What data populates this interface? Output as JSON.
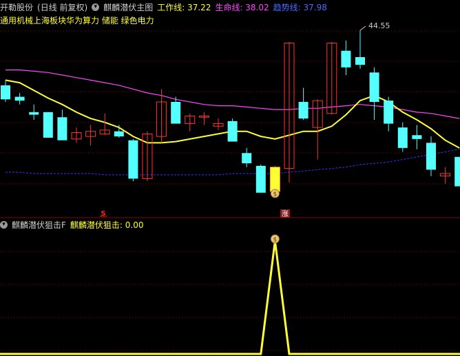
{
  "main_header": {
    "stock_name": "开勒股份",
    "period": "(日线 前复权)",
    "indicator_name": "麒麟潜伏主图",
    "work_line_label": "工作线: 37.22",
    "life_line_label": "生命线: 38.02",
    "trend_line_label": "趋势线: 37.98",
    "concepts": "通用机械上海板块华为算力 储能 绿色电力"
  },
  "sub_header": {
    "indicator_name": "麒麟潜伏狙击F",
    "value_label": "麒麟潜伏狙击: 0.00"
  },
  "markers": {
    "peak_label": "44.55",
    "coin_glyph": "$",
    "s_marker": "S",
    "zhang_marker": "涨"
  },
  "colors": {
    "background": "#000000",
    "up": "#ff3333",
    "down": "#54ffff",
    "work_line": "#ffff33",
    "life_line": "#ff44ff",
    "trend_line": "#3333ff",
    "grid": "#8b0000",
    "text_label": "#cccccc"
  },
  "chart_data": {
    "type": "candlestick",
    "y_range": [
      31.5,
      45.5
    ],
    "candles": [
      {
        "o": 39.8,
        "h": 40.2,
        "l": 38.5,
        "c": 38.7
      },
      {
        "o": 38.9,
        "h": 39.2,
        "l": 38.3,
        "c": 38.6
      },
      {
        "o": 37.7,
        "h": 38.3,
        "l": 37.1,
        "c": 37.5
      },
      {
        "o": 37.7,
        "h": 37.7,
        "l": 35.9,
        "c": 35.7
      },
      {
        "o": 37.3,
        "h": 37.9,
        "l": 35.6,
        "c": 35.5
      },
      {
        "o": 35.6,
        "h": 36.5,
        "l": 35.3,
        "c": 36.1
      },
      {
        "o": 35.8,
        "h": 36.7,
        "l": 35.1,
        "c": 36.2
      },
      {
        "o": 36.0,
        "h": 37.6,
        "l": 35.9,
        "c": 36.3
      },
      {
        "o": 36.2,
        "h": 36.7,
        "l": 35.7,
        "c": 35.8
      },
      {
        "o": 35.5,
        "h": 35.6,
        "l": 32.3,
        "c": 32.5
      },
      {
        "o": 32.5,
        "h": 36.2,
        "l": 32.3,
        "c": 36.0
      },
      {
        "o": 35.8,
        "h": 39.5,
        "l": 35.3,
        "c": 38.5
      },
      {
        "o": 38.5,
        "h": 38.9,
        "l": 36.9,
        "c": 36.8
      },
      {
        "o": 36.8,
        "h": 37.6,
        "l": 36.2,
        "c": 37.4
      },
      {
        "o": 37.3,
        "h": 37.7,
        "l": 36.7,
        "c": 37.4
      },
      {
        "o": 36.6,
        "h": 37.2,
        "l": 36.3,
        "c": 36.8
      },
      {
        "o": 37.0,
        "h": 37.2,
        "l": 35.7,
        "c": 35.4
      },
      {
        "o": 34.5,
        "h": 34.9,
        "l": 33.4,
        "c": 33.7
      },
      {
        "o": 33.5,
        "h": 33.6,
        "l": 31.5,
        "c": 31.4
      },
      {
        "o": 31.5,
        "h": 33.5,
        "l": 31.5,
        "c": 33.4
      },
      {
        "o": 33.3,
        "h": 43.2,
        "l": 32.2,
        "c": 43.1
      },
      {
        "o": 38.5,
        "h": 39.6,
        "l": 37.1,
        "c": 37.2
      },
      {
        "o": 36.5,
        "h": 38.7,
        "l": 34.0,
        "c": 38.6
      },
      {
        "o": 37.6,
        "h": 43.2,
        "l": 37.5,
        "c": 43.1
      },
      {
        "o": 42.5,
        "h": 43.3,
        "l": 40.6,
        "c": 41.2
      },
      {
        "o": 42.0,
        "h": 44.1,
        "l": 41.1,
        "c": 41.4
      },
      {
        "o": 40.8,
        "h": 41.2,
        "l": 37.1,
        "c": 38.5
      },
      {
        "o": 38.6,
        "h": 38.9,
        "l": 36.2,
        "c": 36.8
      },
      {
        "o": 36.5,
        "h": 36.9,
        "l": 34.6,
        "c": 34.9
      },
      {
        "o": 35.9,
        "h": 36.7,
        "l": 34.8,
        "c": 35.6
      },
      {
        "o": 35.3,
        "h": 35.8,
        "l": 32.7,
        "c": 33.2
      },
      {
        "o": 32.7,
        "h": 33.4,
        "l": 32.1,
        "c": 32.9
      },
      {
        "o": 34.2,
        "h": 34.2,
        "l": 32.1,
        "c": 31.9
      }
    ],
    "work_line": [
      40.2,
      40.0,
      39.4,
      38.8,
      38.3,
      37.7,
      37.2,
      36.9,
      36.5,
      35.8,
      35.3,
      35.3,
      35.4,
      35.6,
      35.8,
      36.0,
      36.2,
      36.2,
      35.8,
      35.6,
      35.9,
      36.2,
      36.2,
      36.6,
      37.5,
      38.6,
      39.0,
      38.5,
      37.7,
      37.1,
      36.4,
      35.5,
      34.9
    ],
    "life_line": [
      41.0,
      41.0,
      40.9,
      40.8,
      40.6,
      40.4,
      40.2,
      40.0,
      39.8,
      39.5,
      39.2,
      39.0,
      38.7,
      38.5,
      38.3,
      38.2,
      38.2,
      38.1,
      38.0,
      37.9,
      37.9,
      38.0,
      38.0,
      38.1,
      38.2,
      38.3,
      38.2,
      38.1,
      37.9,
      37.7,
      37.6,
      37.4,
      37.2
    ],
    "trend_line": [
      33.0,
      33.0,
      32.9,
      32.9,
      32.9,
      32.9,
      32.9,
      32.8,
      32.8,
      32.8,
      32.8,
      32.8,
      32.8,
      32.8,
      32.8,
      32.8,
      32.9,
      32.9,
      32.9,
      32.9,
      33.0,
      33.1,
      33.2,
      33.3,
      33.4,
      33.6,
      33.7,
      33.8,
      34.0,
      34.2,
      34.4,
      34.6,
      34.8
    ],
    "sniper": {
      "values": [
        0,
        0,
        0,
        0,
        0,
        0,
        0,
        0,
        0,
        0,
        0,
        0,
        0,
        0,
        0,
        0,
        0,
        0,
        0,
        1,
        0,
        0,
        0,
        0,
        0,
        0,
        0,
        0,
        0,
        0,
        0,
        0,
        0
      ],
      "y_range": [
        0,
        1
      ]
    }
  }
}
